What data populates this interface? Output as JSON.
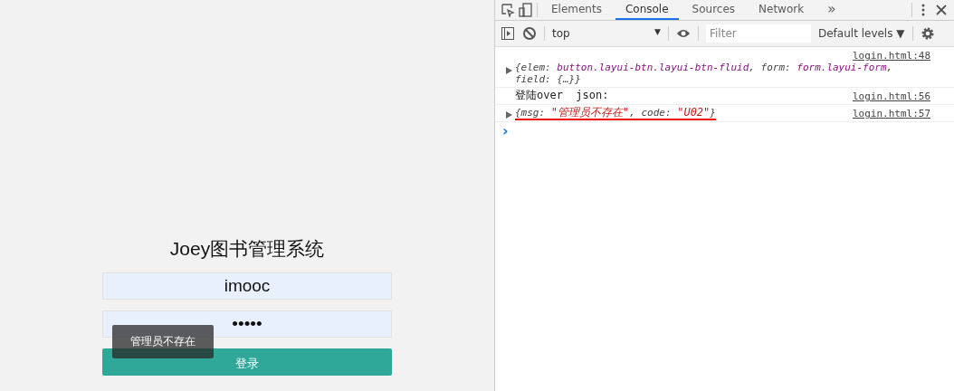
{
  "login": {
    "title": "Joey图书管理系统",
    "username": {
      "value": "imooc"
    },
    "password": {
      "value": "•••••"
    },
    "submit": "登录",
    "toast": "管理员不存在"
  },
  "devtools": {
    "tabs": [
      {
        "label": "Elements",
        "selected": false
      },
      {
        "label": "Console",
        "selected": true
      },
      {
        "label": "Sources",
        "selected": false
      },
      {
        "label": "Network",
        "selected": false
      }
    ],
    "more": "»",
    "context": "top",
    "context_caret": "▼",
    "filter": {
      "placeholder": "Filter"
    },
    "levels": "Default levels ▼",
    "messages": [
      {
        "source": "login.html:48",
        "expandable": true,
        "underlined": false,
        "segments": [
          {
            "kind": "punct",
            "text": "{elem: "
          },
          {
            "kind": "node",
            "text": "button.layui-btn.layui-btn-fluid"
          },
          {
            "kind": "punct",
            "text": ", form: "
          },
          {
            "kind": "node",
            "text": "form.layui-form"
          },
          {
            "kind": "punct",
            "text": ", field: {…}}"
          }
        ]
      },
      {
        "source": "login.html:56",
        "expandable": false,
        "underlined": false,
        "segments": [
          {
            "kind": "plain",
            "text": "登陆over  json:"
          }
        ]
      },
      {
        "source": "login.html:57",
        "expandable": true,
        "underlined": true,
        "segments": [
          {
            "kind": "punct",
            "text": "{msg: "
          },
          {
            "kind": "string",
            "text": "\"管理员不存在\""
          },
          {
            "kind": "punct",
            "text": ", code: "
          },
          {
            "kind": "string",
            "text": "\"U02\""
          },
          {
            "kind": "punct",
            "text": "}"
          }
        ]
      }
    ],
    "prompt": "›"
  }
}
